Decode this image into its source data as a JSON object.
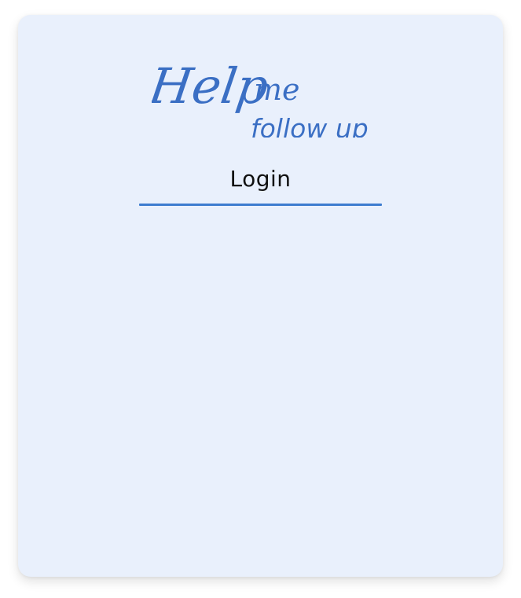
{
  "logo": {
    "word_help": "Help",
    "word_me": "me",
    "word_follow_up": "follow up",
    "color": "#3b6fc4"
  },
  "tabs": [
    {
      "label": "Login",
      "active": true
    }
  ],
  "colors": {
    "card_background": "#e9f0fc",
    "accent": "#3d7ccf"
  }
}
